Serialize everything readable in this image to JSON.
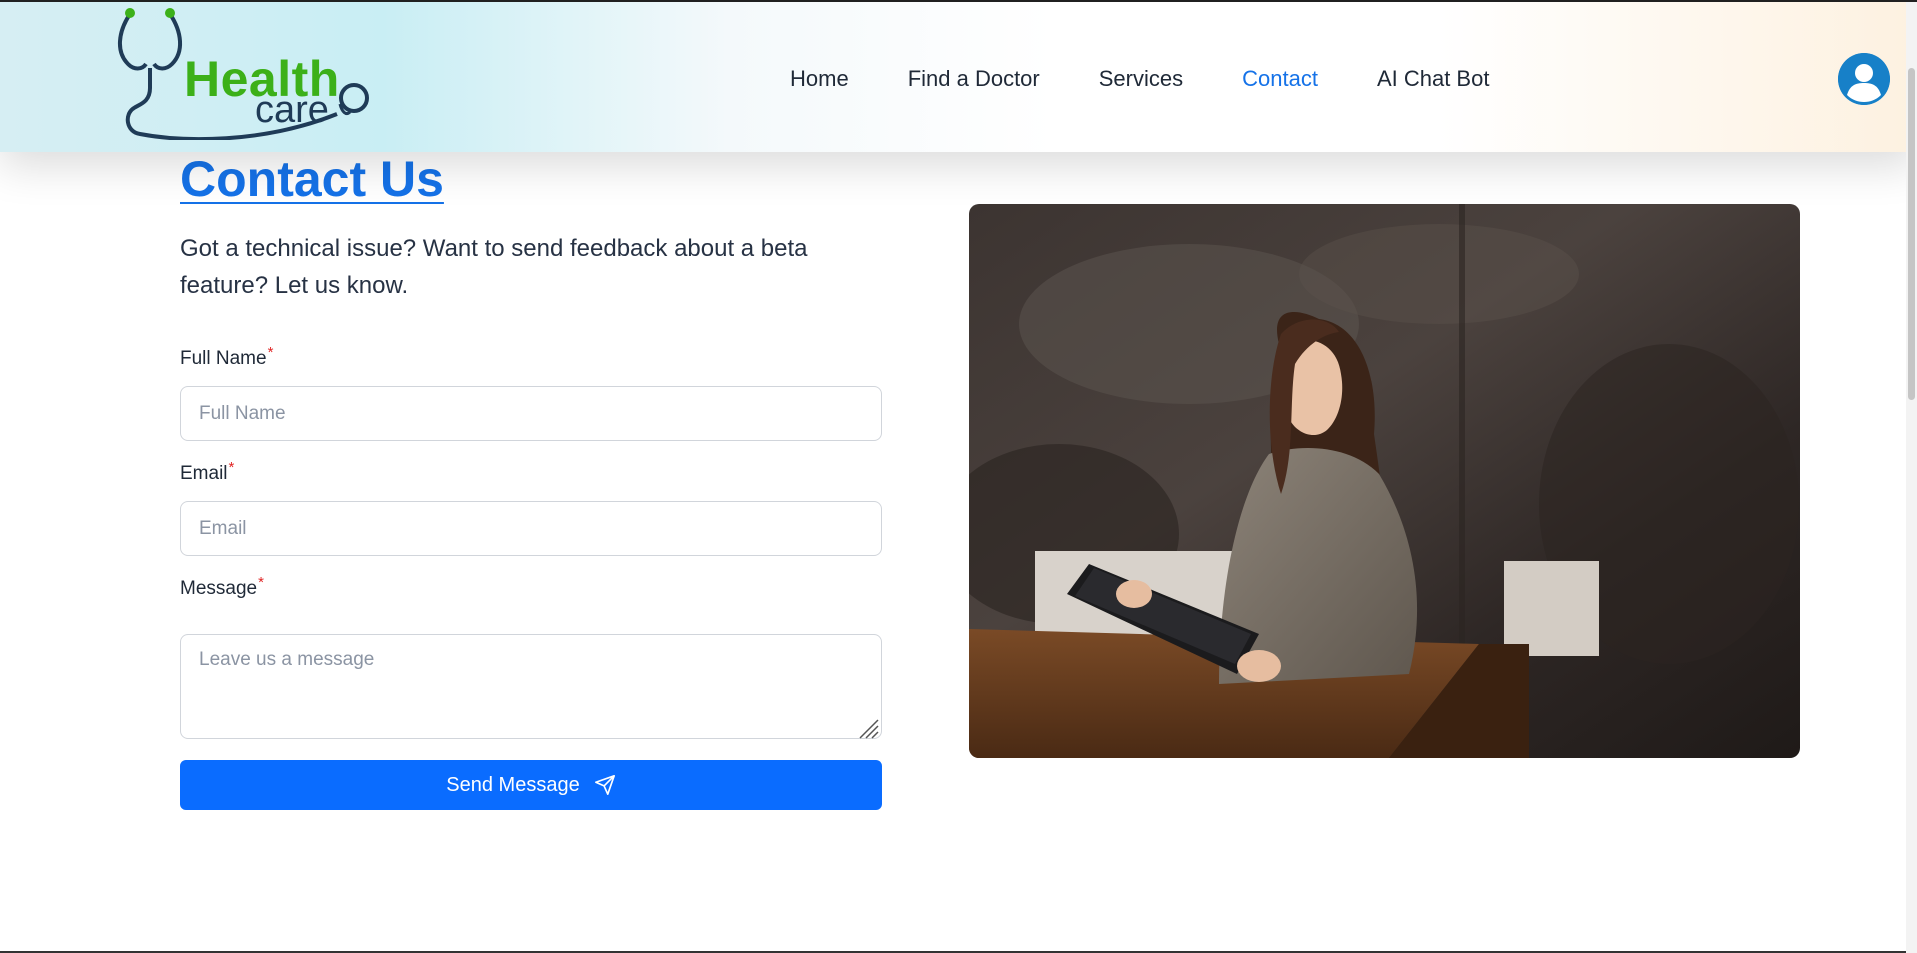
{
  "brand": {
    "name_part1": "Health",
    "name_part2": "care",
    "green": "#3cb019",
    "navy": "#1f3b57"
  },
  "nav": {
    "items": [
      {
        "label": "Home",
        "active": false
      },
      {
        "label": "Find a Doctor",
        "active": false
      },
      {
        "label": "Services",
        "active": false
      },
      {
        "label": "Contact",
        "active": true
      },
      {
        "label": "AI Chat Bot",
        "active": false
      }
    ],
    "active_color": "#1572e8"
  },
  "user": {
    "icon": "user-avatar-icon"
  },
  "contact": {
    "title": "Contact Us",
    "subtitle": "Got a technical issue? Want to send feedback about a beta feature? Let us know.",
    "form": {
      "full_name": {
        "label": "Full Name",
        "required_mark": "*",
        "placeholder": "Full Name",
        "value": ""
      },
      "email": {
        "label": "Email",
        "required_mark": "*",
        "placeholder": "Email",
        "value": ""
      },
      "message": {
        "label": "Message",
        "required_mark": "*",
        "placeholder": "Leave us a message",
        "value": ""
      },
      "submit": {
        "label": "Send Message",
        "icon": "paper-plane-icon"
      }
    },
    "button_color": "#0a6cff"
  }
}
